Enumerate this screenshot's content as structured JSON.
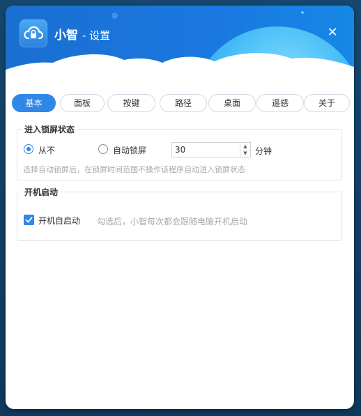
{
  "window": {
    "app_name": "小智",
    "title_suffix": "- 设置",
    "close_glyph": "✕"
  },
  "tabs": [
    {
      "label": "基本",
      "active": true
    },
    {
      "label": "面板",
      "active": false
    },
    {
      "label": "按键",
      "active": false
    },
    {
      "label": "路径",
      "active": false
    },
    {
      "label": "桌面",
      "active": false
    },
    {
      "label": "遥感",
      "active": false
    },
    {
      "label": "关于",
      "active": false
    }
  ],
  "lock_screen": {
    "title": "进入锁屏状态",
    "option_never": "从不",
    "option_auto": "自动锁屏",
    "selected": "never",
    "minutes_value": "30",
    "minutes_unit": "分钟",
    "hint": "选择自动锁屏后，在锁屏时间范围不操作该程序自动进入锁屏状态"
  },
  "startup": {
    "title": "开机启动",
    "checkbox_label": "开机自启动",
    "checked": true,
    "hint": "勾选后，小智每次都会跟随电脑开机启动"
  },
  "icons": {
    "app": "cloud-lock-icon",
    "close": "close-icon",
    "check": "check-icon",
    "spin_up": "chevron-up-icon",
    "spin_down": "chevron-down-icon"
  },
  "colors": {
    "accent": "#2f88e8",
    "header": "#1a6fd1",
    "background": "#16476e"
  }
}
